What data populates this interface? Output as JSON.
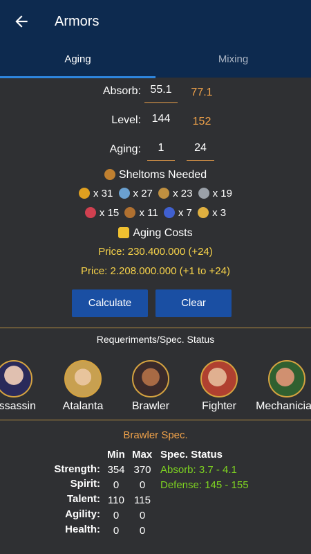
{
  "header": {
    "title": "Armors",
    "back_icon": "arrow-left-icon"
  },
  "tabs": [
    {
      "label": "Aging",
      "active": true
    },
    {
      "label": "Mixing",
      "active": false
    }
  ],
  "form": {
    "absorb": {
      "label": "Absorb:",
      "value": "55.1",
      "result": "77.1"
    },
    "level": {
      "label": "Level:",
      "value": "144",
      "result": "152"
    },
    "aging": {
      "label": "Aging:",
      "from": "1",
      "to": "24"
    }
  },
  "sheltoms": {
    "title": "Sheltoms Needed",
    "row1": [
      {
        "count": "x 31",
        "color": "#e0a020"
      },
      {
        "count": "x 27",
        "color": "#6aa0d0"
      },
      {
        "count": "x 23",
        "color": "#c09040"
      },
      {
        "count": "x 19",
        "color": "#9aa0a8"
      }
    ],
    "row2": [
      {
        "count": "x 15",
        "color": "#d04050"
      },
      {
        "count": "x 11",
        "color": "#b07030"
      },
      {
        "count": "x 7",
        "color": "#4060d0"
      },
      {
        "count": "x 3",
        "color": "#e0b040"
      }
    ]
  },
  "costs": {
    "title": "Aging Costs",
    "price1": "Price:  230.400.000 (+24)",
    "price2": "Price:  2.208.000.000 (+1 to +24)"
  },
  "buttons": {
    "calculate": "Calculate",
    "clear": "Clear"
  },
  "requirements": {
    "title": "Requeriments/Spec. Status",
    "classes": [
      "Assassin",
      "Atalanta",
      "Brawler",
      "Fighter",
      "Mechanician"
    ]
  },
  "spec": {
    "title": "Brawler Spec.",
    "headers": {
      "min": "Min",
      "max": "Max",
      "status": "Spec. Status"
    },
    "rows": [
      {
        "label": "Strength:",
        "min": "354",
        "max": "370"
      },
      {
        "label": "Spirit:",
        "min": "0",
        "max": "0"
      },
      {
        "label": "Talent:",
        "min": "110",
        "max": "115"
      },
      {
        "label": "Agility:",
        "min": "0",
        "max": "0"
      },
      {
        "label": "Health:",
        "min": "0",
        "max": "0"
      }
    ],
    "status": [
      "Absorb: 3.7 - 4.1",
      "Defense: 145 - 155"
    ]
  }
}
